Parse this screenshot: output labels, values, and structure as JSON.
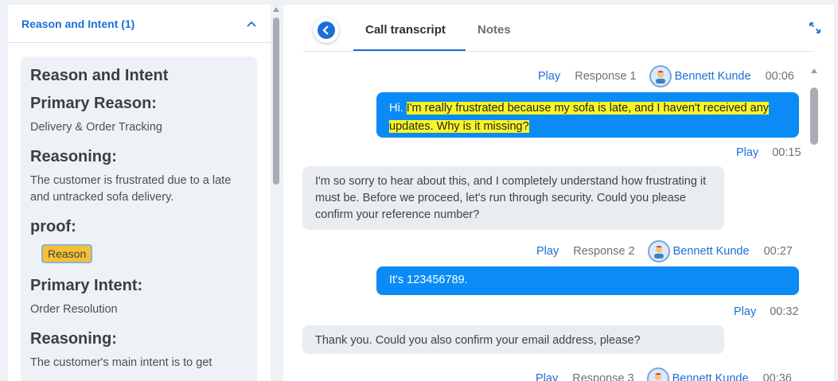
{
  "left_panel": {
    "accordion_title": "Reason and Intent (1)",
    "card": {
      "heading": "Reason and Intent",
      "primary_reason_label": "Primary Reason:",
      "primary_reason_value": "Delivery & Order Tracking",
      "reasoning_label_1": "Reasoning:",
      "reasoning_value_1": "The customer is frustrated due to a late and untracked sofa delivery.",
      "proof_label": "proof:",
      "proof_button": "Reason",
      "primary_intent_label": "Primary Intent:",
      "primary_intent_value": "Order Resolution",
      "reasoning_label_2": "Reasoning:",
      "reasoning_value_2": "The customer's main intent is to get"
    }
  },
  "right_panel": {
    "tabs": [
      {
        "label": "Call transcript",
        "active": true
      },
      {
        "label": "Notes",
        "active": false
      }
    ],
    "messages": [
      {
        "play": "Play",
        "response": "Response 1",
        "agent": "Bennett Kunde",
        "time": "00:06",
        "text_plain": "Hi. ",
        "text_highlight": "I'm really frustrated because my sofa is late, and I haven't received any updates. Why is it missing?"
      },
      {
        "play": "Play",
        "time": "00:15",
        "text": "I'm so sorry to hear about this, and I completely understand how frustrating it must be. Before we proceed, let's run through security. Could you please confirm your reference number?"
      },
      {
        "play": "Play",
        "response": "Response 2",
        "agent": "Bennett Kunde",
        "time": "00:27",
        "text": "It's 123456789."
      },
      {
        "play": "Play",
        "time": "00:32",
        "text": "Thank you. Could you also confirm your email address, please?"
      },
      {
        "play": "Play",
        "response": "Response 3",
        "agent": "Bennett Kunde",
        "time": "00:36"
      }
    ]
  },
  "colors": {
    "accent": "#1a6fd6",
    "customer_bubble": "#0a8bf5",
    "agent_bubble": "#e9edf1",
    "highlight": "#fbf526",
    "proof_button": "#f6c233"
  },
  "icons": [
    "chevron-up-icon",
    "back-arrow-icon",
    "expand-icon",
    "avatar-icon"
  ]
}
